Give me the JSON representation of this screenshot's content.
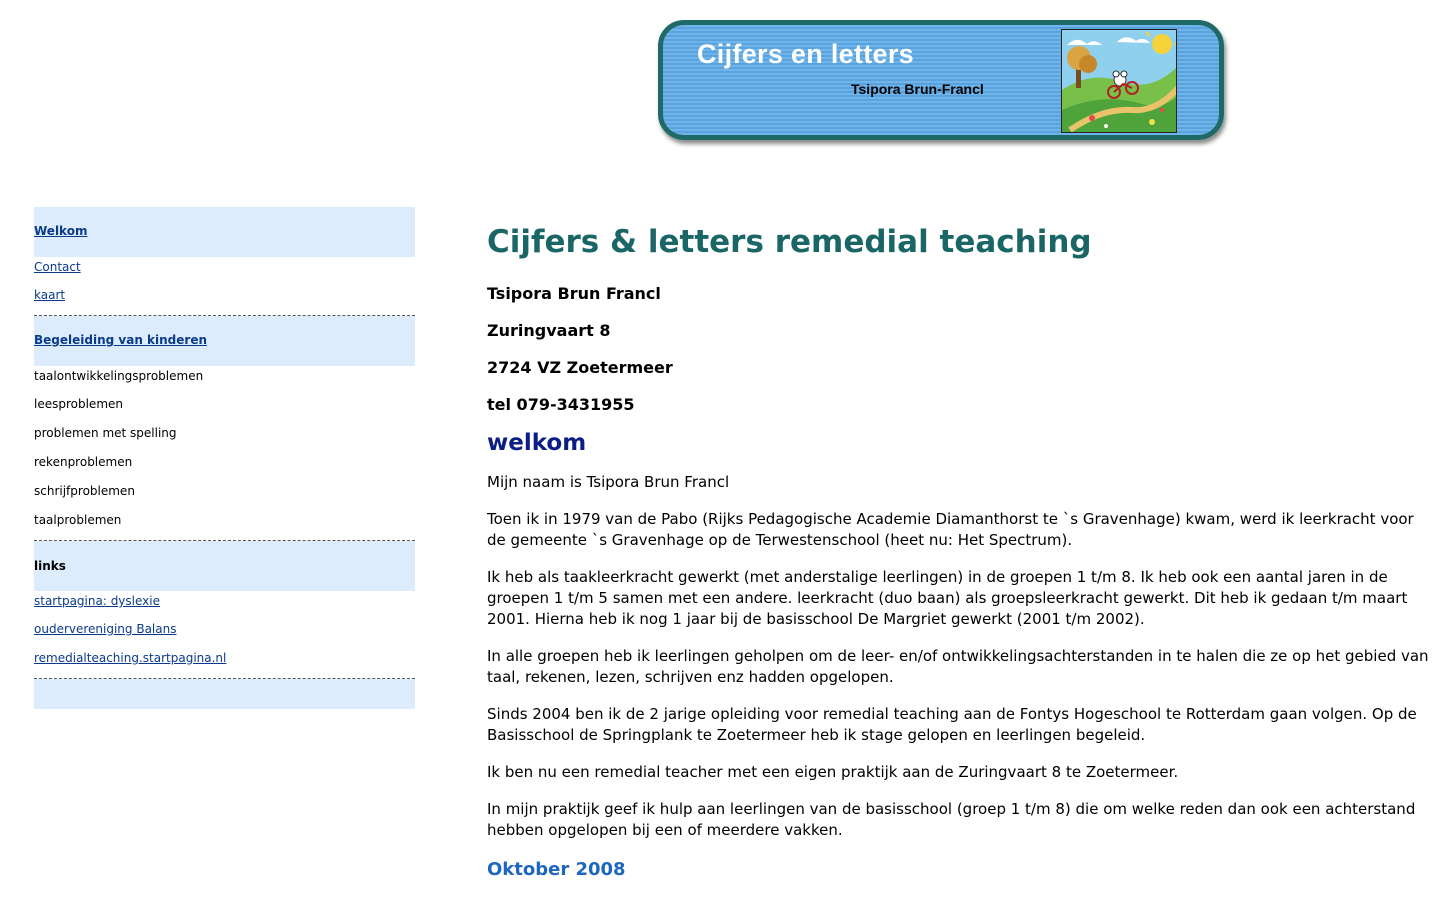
{
  "banner": {
    "title": "Cijfers en letters",
    "subtitle": "Tsipora Brun-Francl"
  },
  "sidebar": {
    "section1": {
      "heading": "Welkom",
      "items": [
        "Contact",
        "kaart"
      ]
    },
    "section2": {
      "heading": "Begeleiding van kinderen",
      "items": [
        "taalontwikkelingsproblemen",
        "leesproblemen",
        "problemen met spelling",
        "rekenproblemen",
        "schrijfproblemen",
        "taalproblemen"
      ]
    },
    "section3": {
      "heading": "links",
      "items": [
        "startpagina: dyslexie",
        "oudervereniging Balans",
        "remedialteaching.startpagina.nl"
      ]
    }
  },
  "main": {
    "title": "Cijfers & letters remedial teaching",
    "address": [
      "Tsipora Brun Francl",
      "Zuringvaart 8",
      "2724 VZ Zoetermeer",
      "tel 079-3431955"
    ],
    "welcome_heading": "welkom",
    "paragraphs": [
      "Mijn naam is Tsipora Brun Francl",
      "Toen ik in 1979 van de Pabo (Rijks Pedagogische Academie Diamanthorst te `s Gravenhage) kwam, werd ik leerkracht voor de gemeente `s Gravenhage op de Terwestenschool (heet nu: Het Spectrum).",
      "Ik heb als taakleerkracht gewerkt (met anderstalige leerlingen) in de groepen 1 t/m 8. Ik heb ook een aantal jaren in de groepen 1 t/m 5 samen met een andere. leerkracht (duo baan) als groepsleerkracht gewerkt. Dit heb ik gedaan t/m maart 2001. Hierna heb ik nog 1 jaar bij de basisschool De Margriet gewerkt (2001 t/m 2002).",
      "In alle groepen heb ik leerlingen geholpen om de leer- en/of ontwikkelingsachterstanden in te halen die ze op het gebied van taal, rekenen, lezen, schrijven enz hadden opgelopen.",
      "Sinds 2004 ben ik de 2 jarige opleiding voor remedial teaching aan de Fontys Hogeschool te Rotterdam gaan volgen. Op de Basisschool de Springplank te Zoetermeer heb ik stage gelopen en leerlingen begeleid.",
      "Ik ben nu een remedial teacher met een eigen praktijk aan de Zuringvaart 8 te Zoetermeer.",
      "In mijn praktijk geef ik hulp aan leerlingen van de basisschool (groep 1 t/m 8) die om welke reden dan ook een achterstand hebben opgelopen bij een of meerdere vakken."
    ],
    "date_heading": "Oktober 2008"
  }
}
